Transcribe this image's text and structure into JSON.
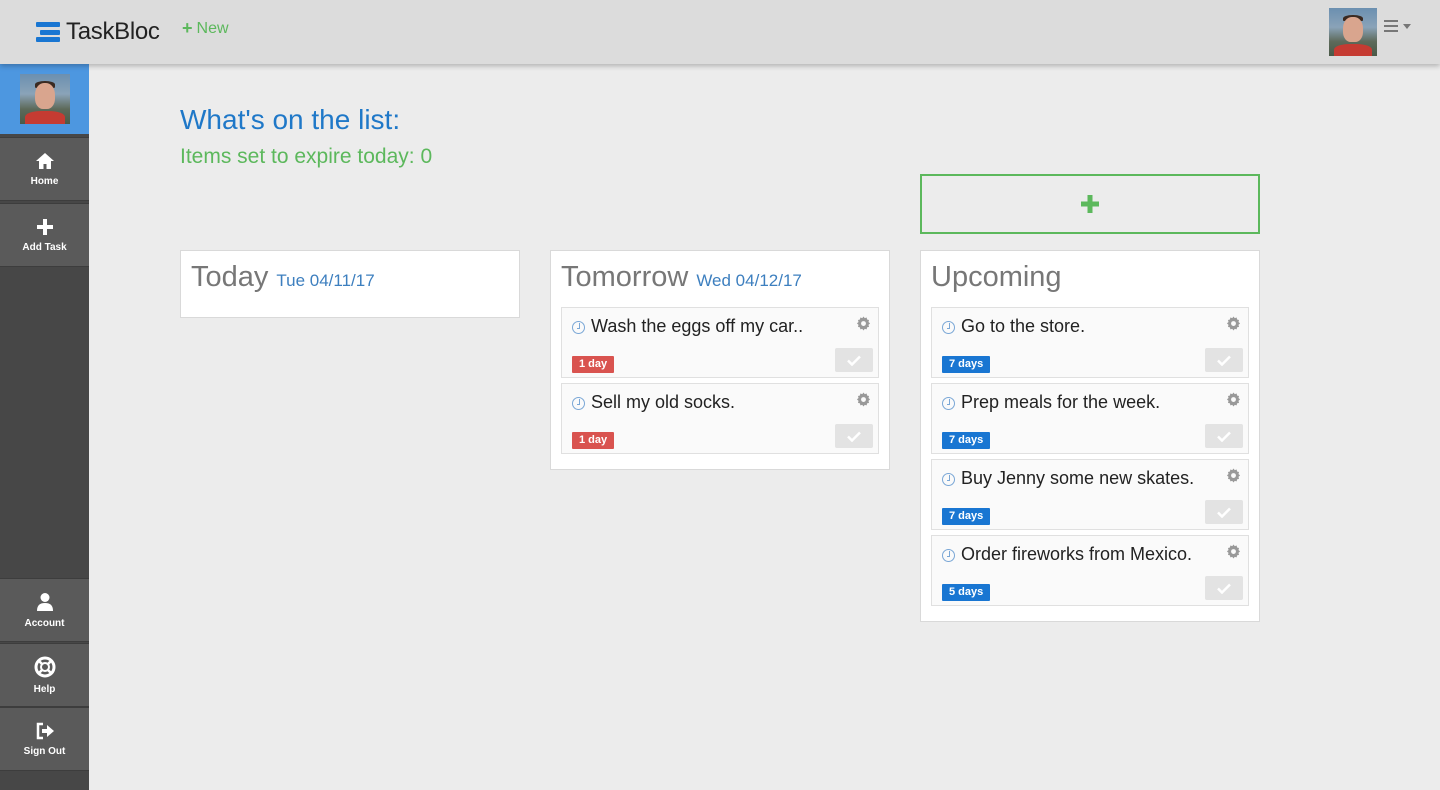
{
  "header": {
    "brand": "TaskBloc",
    "new_label": "New",
    "brand_color": "#1976d2",
    "accent_green": "#5cb85c"
  },
  "sidebar": {
    "items": [
      {
        "label": "Home",
        "icon": "home-icon"
      },
      {
        "label": "Add Task",
        "icon": "plus-icon"
      },
      {
        "label": "Account",
        "icon": "user-icon"
      },
      {
        "label": "Help",
        "icon": "life-ring-icon"
      },
      {
        "label": "Sign Out",
        "icon": "sign-out-icon"
      }
    ]
  },
  "main": {
    "title": "What's on the list:",
    "expire_label": "Items set to expire today: 0"
  },
  "columns": {
    "today": {
      "title": "Today",
      "date": "Tue 04/11/17",
      "tasks": []
    },
    "tomorrow": {
      "title": "Tomorrow",
      "date": "Wed 04/12/17",
      "tasks": [
        {
          "text": "Wash the eggs off my car..",
          "badge": "1 day",
          "badge_color": "#d9534f"
        },
        {
          "text": "Sell my old socks.",
          "badge": "1 day",
          "badge_color": "#d9534f"
        }
      ]
    },
    "upcoming": {
      "title": "Upcoming",
      "tasks": [
        {
          "text": "Go to the store.",
          "badge": "7 days",
          "badge_color": "#1976d2"
        },
        {
          "text": "Prep meals for the week.",
          "badge": "7 days",
          "badge_color": "#1976d2"
        },
        {
          "text": "Buy Jenny some new skates.",
          "badge": "7 days",
          "badge_color": "#1976d2"
        },
        {
          "text": "Order fireworks from Mexico.",
          "badge": "5 days",
          "badge_color": "#1976d2"
        }
      ]
    }
  }
}
